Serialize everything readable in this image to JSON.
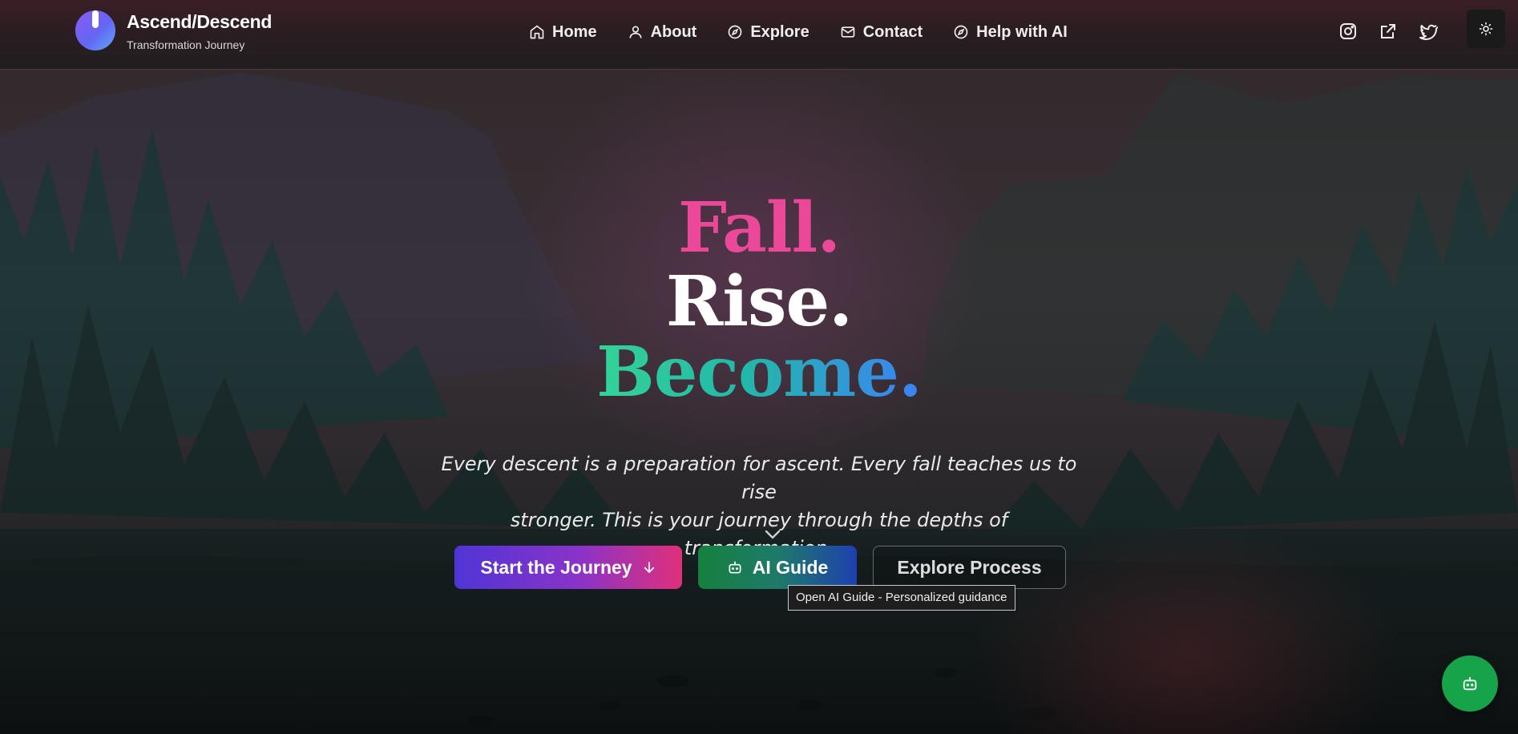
{
  "header": {
    "brand_title": "Ascend/Descend",
    "brand_subtitle": "Transformation Journey",
    "nav": [
      {
        "label": "Home",
        "icon": "home-icon"
      },
      {
        "label": "About",
        "icon": "user-icon"
      },
      {
        "label": "Explore",
        "icon": "compass-icon"
      },
      {
        "label": "Contact",
        "icon": "mail-icon"
      },
      {
        "label": "Help with AI",
        "icon": "compass-icon"
      }
    ],
    "social": [
      "instagram-icon",
      "external-link-icon",
      "twitter-icon"
    ],
    "theme_toggle_icon": "sun-icon"
  },
  "hero": {
    "line1": "Fall.",
    "line2": "Rise.",
    "line3": "Become.",
    "tagline_line1": "Every descent is a preparation for ascent. Every fall teaches us to rise",
    "tagline_line2": "stronger. This is your journey through the depths of transformation.",
    "scroll_icon": "chevron-down-icon"
  },
  "buttons": {
    "start": "Start the Journey",
    "ai_guide": "AI Guide",
    "explore": "Explore Process"
  },
  "tooltip": "Open AI Guide - Personalized guidance",
  "fab_icon": "bot-icon",
  "colors": {
    "fall": "#ec4899",
    "rise": "#ffffff",
    "become_start": "#34d399",
    "become_end": "#3b82f6",
    "fab": "#16a34a"
  }
}
